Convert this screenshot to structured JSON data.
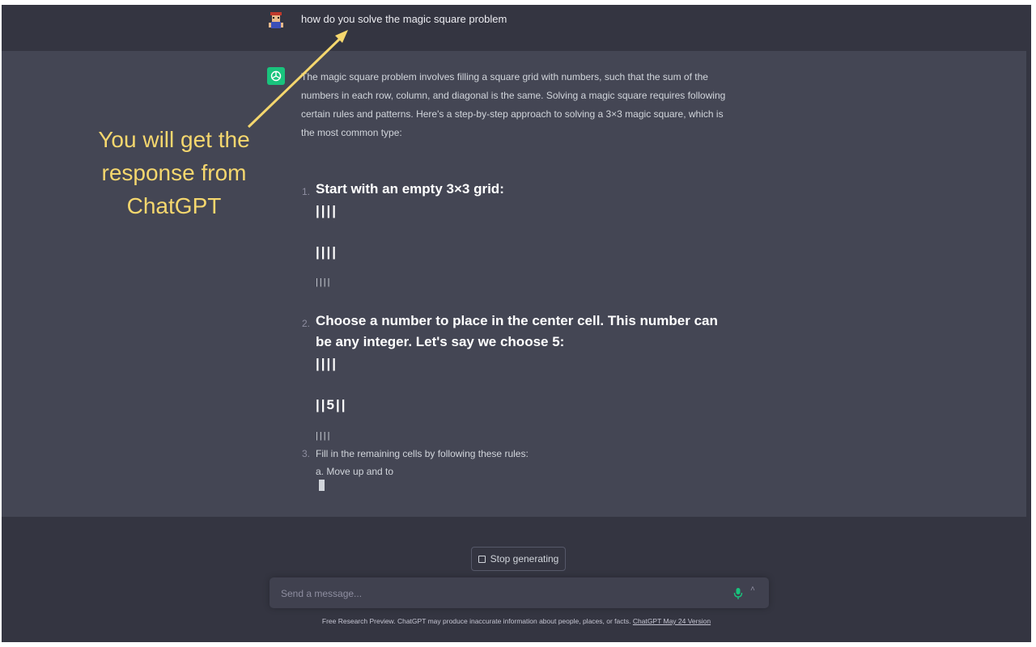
{
  "user_message": {
    "text": "how do you solve the magic square problem"
  },
  "assistant_message": {
    "intro": "The magic square problem involves filling a square grid with numbers, such that the sum of the numbers in each row, column, and diagonal is the same. Solving a magic square requires following certain rules and patterns. Here's a step-by-step approach to solving a 3×3 magic square, which is the most common type:",
    "steps": [
      {
        "number": "1.",
        "heading": "Start with an empty 3×3 grid:",
        "lines": [
          "||||",
          "||||",
          "||||"
        ]
      },
      {
        "number": "2.",
        "heading": "Choose a number to place in the center cell. This number can be any integer. Let's say we choose 5:",
        "lines": [
          "||||",
          "||5||",
          "||||"
        ]
      },
      {
        "number": "3.",
        "heading": "Fill in the remaining cells by following these rules:",
        "sub": "a. Move up and to"
      }
    ]
  },
  "controls": {
    "stop_label": "Stop generating",
    "input_placeholder": "Send a message...",
    "mic_icon": "microphone-icon",
    "send_icon": "send-icon"
  },
  "footer": {
    "text": "Free Research Preview. ChatGPT may produce inaccurate information about people, places, or facts.",
    "link": "ChatGPT May 24 Version"
  },
  "annotation": {
    "text": "You will get the response from ChatGPT",
    "color": "#f5d76e"
  },
  "colors": {
    "background": "#343541",
    "assistant_background": "#444654",
    "accent": "#19c37d"
  }
}
